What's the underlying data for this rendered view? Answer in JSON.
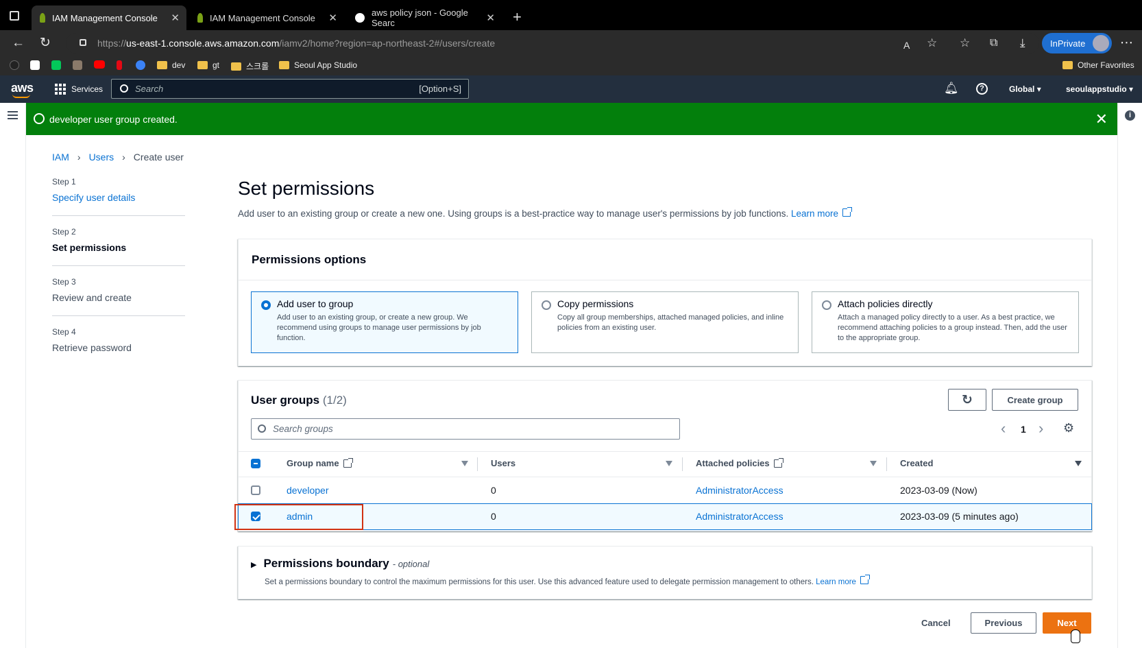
{
  "browser": {
    "tabs": [
      {
        "title": "IAM Management Console",
        "active": true
      },
      {
        "title": "IAM Management Console",
        "active": false
      },
      {
        "title": "aws policy json - Google Searc",
        "active": false
      }
    ],
    "url_prefix": "https://",
    "url_host": "us-east-1.console.aws.amazon.com",
    "url_path": "/iamv2/home?region=ap-northeast-2#/users/create",
    "inprivate_label": "InPrivate",
    "favorites": [
      "dev",
      "gt",
      "스크롤",
      "Seoul App Studio"
    ],
    "other_favorites": "Other Favorites"
  },
  "aws_nav": {
    "logo": "aws",
    "services": "Services",
    "search_placeholder": "Search",
    "search_shortcut": "[Option+S]",
    "region": "Global",
    "account": "seoulappstudio"
  },
  "flash": {
    "message": "developer user group created."
  },
  "breadcrumb": [
    "IAM",
    "Users",
    "Create user"
  ],
  "steps": [
    {
      "label": "Step 1",
      "name": "Specify user details"
    },
    {
      "label": "Step 2",
      "name": "Set permissions"
    },
    {
      "label": "Step 3",
      "name": "Review and create"
    },
    {
      "label": "Step 4",
      "name": "Retrieve password"
    }
  ],
  "main": {
    "title": "Set permissions",
    "description": "Add user to an existing group or create a new one. Using groups is a best-practice way to manage user's permissions by job functions.",
    "learn_more": "Learn more"
  },
  "permissions_options": {
    "heading": "Permissions options",
    "options": [
      {
        "title": "Add user to group",
        "desc": "Add user to an existing group, or create a new group. We recommend using groups to manage user permissions by job function.",
        "selected": true
      },
      {
        "title": "Copy permissions",
        "desc": "Copy all group memberships, attached managed policies, and inline policies from an existing user.",
        "selected": false
      },
      {
        "title": "Attach policies directly",
        "desc": "Attach a managed policy directly to a user. As a best practice, we recommend attaching policies to a group instead. Then, add the user to the appropriate group.",
        "selected": false
      }
    ]
  },
  "user_groups": {
    "heading": "User groups",
    "count": "(1/2)",
    "create_button": "Create group",
    "search_placeholder": "Search groups",
    "page": "1",
    "columns": [
      "Group name",
      "Users",
      "Attached policies",
      "Created"
    ],
    "rows": [
      {
        "name": "developer",
        "users": "0",
        "policies": "AdministratorAccess",
        "created": "2023-03-09 (Now)",
        "checked": false
      },
      {
        "name": "admin",
        "users": "0",
        "policies": "AdministratorAccess",
        "created": "2023-03-09 (5 minutes ago)",
        "checked": true
      }
    ]
  },
  "boundary": {
    "title": "Permissions boundary",
    "optional": "- optional",
    "desc": "Set a permissions boundary to control the maximum permissions for this user. Use this advanced feature used to delegate permission management to others.",
    "learn_more": "Learn more"
  },
  "footer": {
    "cancel": "Cancel",
    "previous": "Previous",
    "next": "Next"
  },
  "colors": {
    "flash_green": "#037f0c",
    "link_blue": "#0972d3",
    "primary_orange": "#ec7211",
    "highlight_red": "#d13212",
    "aws_nav": "#232f3e"
  }
}
